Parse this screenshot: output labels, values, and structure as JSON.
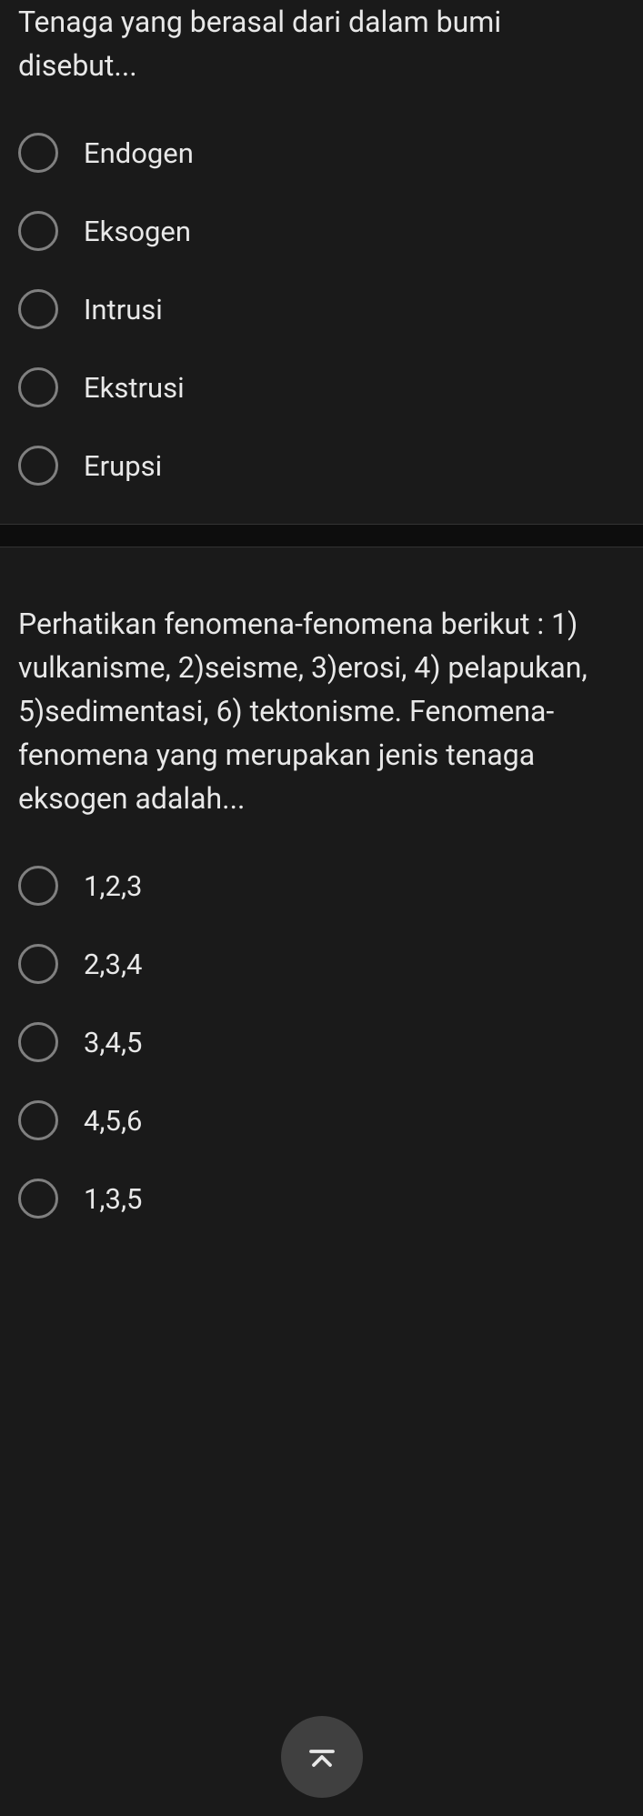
{
  "questions": [
    {
      "text": "Tenaga yang berasal dari dalam bumi disebut...",
      "options": [
        {
          "label": "Endogen"
        },
        {
          "label": "Eksogen"
        },
        {
          "label": "Intrusi"
        },
        {
          "label": "Ekstrusi"
        },
        {
          "label": "Erupsi"
        }
      ]
    },
    {
      "text": "Perhatikan fenomena-fenomena berikut : 1) vulkanisme, 2)seisme, 3)erosi, 4) pelapukan, 5)sedimentasi, 6) tektonisme. Fenomena-fenomena yang merupakan jenis tenaga eksogen adalah...",
      "options": [
        {
          "label": "1,2,3"
        },
        {
          "label": "2,3,4"
        },
        {
          "label": "3,4,5"
        },
        {
          "label": "4,5,6"
        },
        {
          "label": "1,3,5"
        }
      ]
    }
  ]
}
